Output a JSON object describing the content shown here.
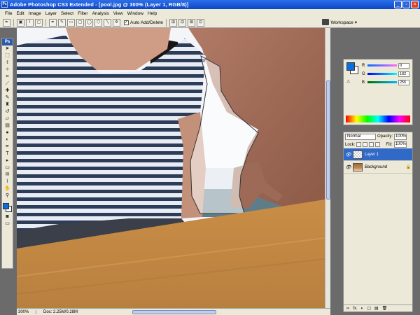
{
  "window": {
    "title": "Adobe Photoshop CS3 Extended - [pool.jpg @ 300% (Layer 1, RGB/8)]",
    "logo": "Ps",
    "minimize": "_",
    "restore": "▫",
    "close": "×"
  },
  "menu": [
    "File",
    "Edit",
    "Image",
    "Layer",
    "Select",
    "Filter",
    "Analysis",
    "View",
    "Window",
    "Help"
  ],
  "options_bar": {
    "auto_add_delete_label": "Auto Add/Delete",
    "auto_add_delete_checked": "✓",
    "workspace_label": "Workspace ▾"
  },
  "toolbox": {
    "logo": "Ps",
    "tools": [
      {
        "name": "move-tool",
        "glyph": "➤"
      },
      {
        "name": "marquee-tool",
        "glyph": "⬚"
      },
      {
        "name": "lasso-tool",
        "glyph": "ℓ"
      },
      {
        "name": "magic-wand-tool",
        "glyph": "✧"
      },
      {
        "name": "crop-tool",
        "glyph": "⌗"
      },
      {
        "name": "slice-tool",
        "glyph": "⟋"
      },
      {
        "name": "healing-brush-tool",
        "glyph": "✚"
      },
      {
        "name": "brush-tool",
        "glyph": "✎"
      },
      {
        "name": "clone-stamp-tool",
        "glyph": "♜"
      },
      {
        "name": "history-brush-tool",
        "glyph": "↺"
      },
      {
        "name": "eraser-tool",
        "glyph": "▱"
      },
      {
        "name": "gradient-tool",
        "glyph": "▤"
      },
      {
        "name": "blur-tool",
        "glyph": "●"
      },
      {
        "name": "dodge-tool",
        "glyph": "◐"
      },
      {
        "name": "pen-tool",
        "glyph": "✒"
      },
      {
        "name": "type-tool",
        "glyph": "T"
      },
      {
        "name": "path-selection-tool",
        "glyph": "▸"
      },
      {
        "name": "shape-tool",
        "glyph": "▭"
      },
      {
        "name": "notes-tool",
        "glyph": "✉"
      },
      {
        "name": "eyedropper-tool",
        "glyph": "⌇"
      },
      {
        "name": "hand-tool",
        "glyph": "✋"
      },
      {
        "name": "zoom-tool",
        "glyph": "⚲"
      }
    ]
  },
  "status": {
    "zoom": "300%",
    "doc": "Doc: 2.25M/0.28M"
  },
  "color_panel": {
    "fg_color": "#0a6ee0",
    "rows": [
      {
        "label": "R",
        "value": "0"
      },
      {
        "label": "G",
        "value": "182"
      },
      {
        "label": "B",
        "value": "255"
      }
    ],
    "warn_glyph": "⚠"
  },
  "layers_panel": {
    "blend_mode": "Normal",
    "opacity_label": "Opacity:",
    "opacity_value": "100%",
    "lock_label": "Lock:",
    "fill_label": "Fill:",
    "fill_value": "100%",
    "layers": [
      {
        "name": "Layer 1",
        "active": true
      },
      {
        "name": "Background",
        "active": false,
        "lock": "🔒"
      }
    ],
    "footer": [
      "∞",
      "fx.",
      "◐",
      "▢",
      "▤",
      "🗑"
    ]
  }
}
